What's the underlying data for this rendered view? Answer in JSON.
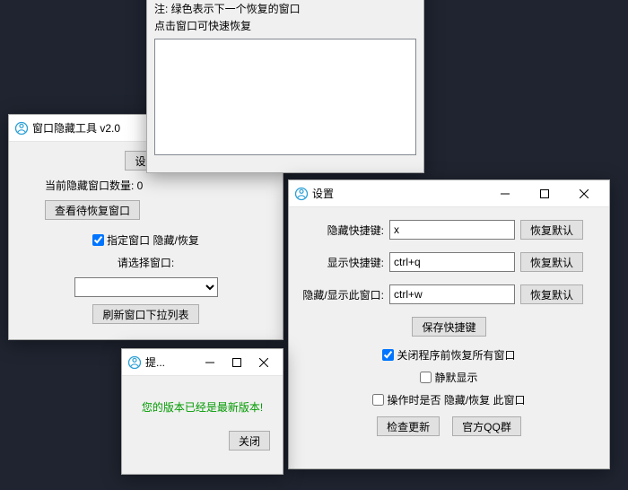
{
  "winA": {
    "note1": "注: 绿色表示下一个恢复的窗口",
    "note2": "点击窗口可快速恢复"
  },
  "winB": {
    "title": "窗口隐藏工具 v2.0",
    "settings_btn": "设置",
    "hide_count_label": "当前隐藏窗口数量: 0",
    "view_pending_btn": "查看待恢复窗口",
    "specific_chk": "指定窗口 隐藏/恢复",
    "select_label": "请选择窗口:",
    "refresh_btn": "刷新窗口下拉列表"
  },
  "winC": {
    "title": "设置",
    "hide_hotkey_label": "隐藏快捷键:",
    "hide_hotkey_value": "x",
    "show_hotkey_label": "显示快捷键:",
    "show_hotkey_value": "ctrl+q",
    "toggle_hotkey_label": "隐藏/显示此窗口:",
    "toggle_hotkey_value": "ctrl+w",
    "restore_default": "恢复默认",
    "save_hotkey_btn": "保存快捷键",
    "restore_all_chk": "关闭程序前恢复所有窗口",
    "silent_chk": "静默显示",
    "confirm_chk": "操作时是否 隐藏/恢复 此窗口",
    "check_update_btn": "检查更新",
    "qq_group_btn": "官方QQ群"
  },
  "winD": {
    "title": "提...",
    "message": "您的版本已经是最新版本!",
    "close_btn": "关闭"
  }
}
